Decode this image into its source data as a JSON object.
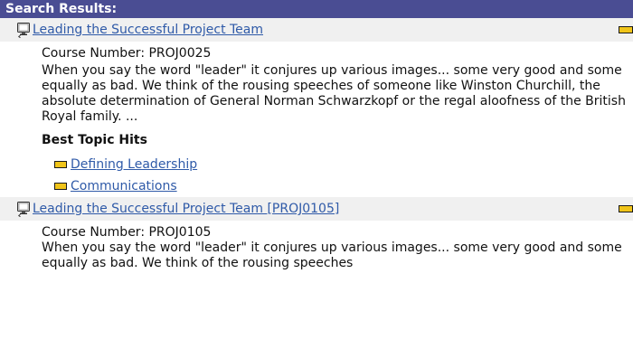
{
  "header": {
    "title": "Search Results:"
  },
  "results": [
    {
      "title": "Leading the Successful Project Team",
      "course_number": "Course Number: PROJ0025",
      "description": "When you say the word \"leader\" it conjures up various images... some very good and some equally as bad. We think of the rousing speeches of someone like Winston Churchill, the absolute determination of General Norman Schwarzkopf or the regal aloofness of the British Royal family. ...",
      "best_topic_hits_label": "Best Topic Hits",
      "topic_hits": [
        {
          "label": "Defining Leadership"
        },
        {
          "label": "Communications"
        }
      ]
    },
    {
      "title": "Leading the Successful Project Team [PROJ0105]",
      "course_number": "Course Number: PROJ0105",
      "description": "When you say the word \"leader\" it conjures up various images... some very good and some equally as bad. We think of the rousing speeches"
    }
  ],
  "colors": {
    "header_bg": "#4a4d93",
    "row_bg": "#f0f0f0",
    "link": "#2f5aa8",
    "bookmark_fill": "#f0c419",
    "bookmark_stroke": "#1a1a1a"
  },
  "icons": {
    "course": "course-monitor-icon",
    "bookmark": "bookmark-icon"
  }
}
